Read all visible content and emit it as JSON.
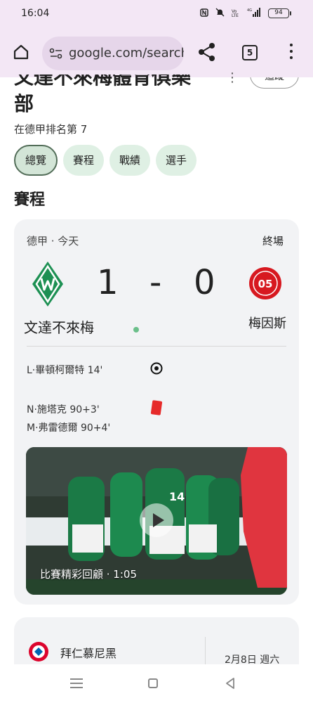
{
  "status_bar": {
    "time": "16:04",
    "signal": "4G",
    "battery": "94",
    "icons": [
      "nfc-icon",
      "mute-icon",
      "volte-icon",
      "signal-icon",
      "battery-icon"
    ]
  },
  "browser": {
    "url": "google.com/search",
    "tab_count": "5",
    "icons": [
      "home-icon",
      "page-info-icon",
      "share-icon",
      "tabs-icon",
      "menu-icon"
    ]
  },
  "header": {
    "title_cut": "文達不來梅體育俱樂",
    "title_line2": "部",
    "follow_label": "追蹤",
    "more": "⋮",
    "rank": "在德甲排名第 7"
  },
  "tabs": [
    {
      "label": "總覽",
      "active": true
    },
    {
      "label": "賽程",
      "active": false
    },
    {
      "label": "戰績",
      "active": false
    },
    {
      "label": "選手",
      "active": false
    }
  ],
  "section_title": "賽程",
  "match": {
    "league": "德甲 · 今天",
    "status": "終場",
    "home_team": "文達不來梅",
    "away_team": "梅因斯",
    "home_score": "1",
    "dash": "-",
    "away_score": "0",
    "events": [
      {
        "text": "L·畢頓柯爾特 14'",
        "type": "goal"
      },
      {
        "text": "N·施塔克 90+3'",
        "type": "red-card"
      },
      {
        "text": "M·弗雷德爾 90+4'",
        "type": "red-card"
      }
    ],
    "video_caption": "比賽精彩回顧 · 1:05"
  },
  "next_match": {
    "team": "拜仁慕尼黑",
    "date": "2月8日 週六"
  },
  "colors": {
    "bar_bg": "#f3e7f5",
    "url_bg": "#e6d6ea",
    "chip_bg": "#dff0e4",
    "card_bg": "#f2f3f5",
    "werder_green": "#1d9053",
    "mainz_red": "#d71920",
    "red_card": "#e62a2a"
  }
}
